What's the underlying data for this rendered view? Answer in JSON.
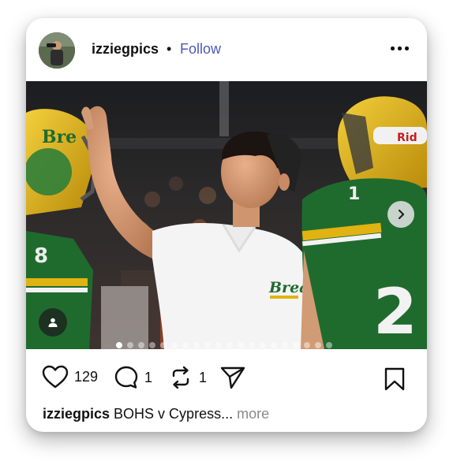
{
  "post": {
    "username": "izziegpics",
    "separator": "•",
    "follow_label": "Follow",
    "menu_icon": "more-horizontal-icon",
    "image_jersey_text": "Brea",
    "carousel": {
      "count": 20,
      "active_index": 0
    },
    "actions": {
      "like_count": "129",
      "comment_count": "1",
      "repost_count": "1"
    },
    "caption": {
      "username": "izziegpics",
      "text": "BOHS v Cypress...",
      "more_label": "more"
    }
  },
  "colors": {
    "follow": "#4b5ab8",
    "jersey_green": "#1f6b2e",
    "helmet_gold": "#e0b312"
  }
}
